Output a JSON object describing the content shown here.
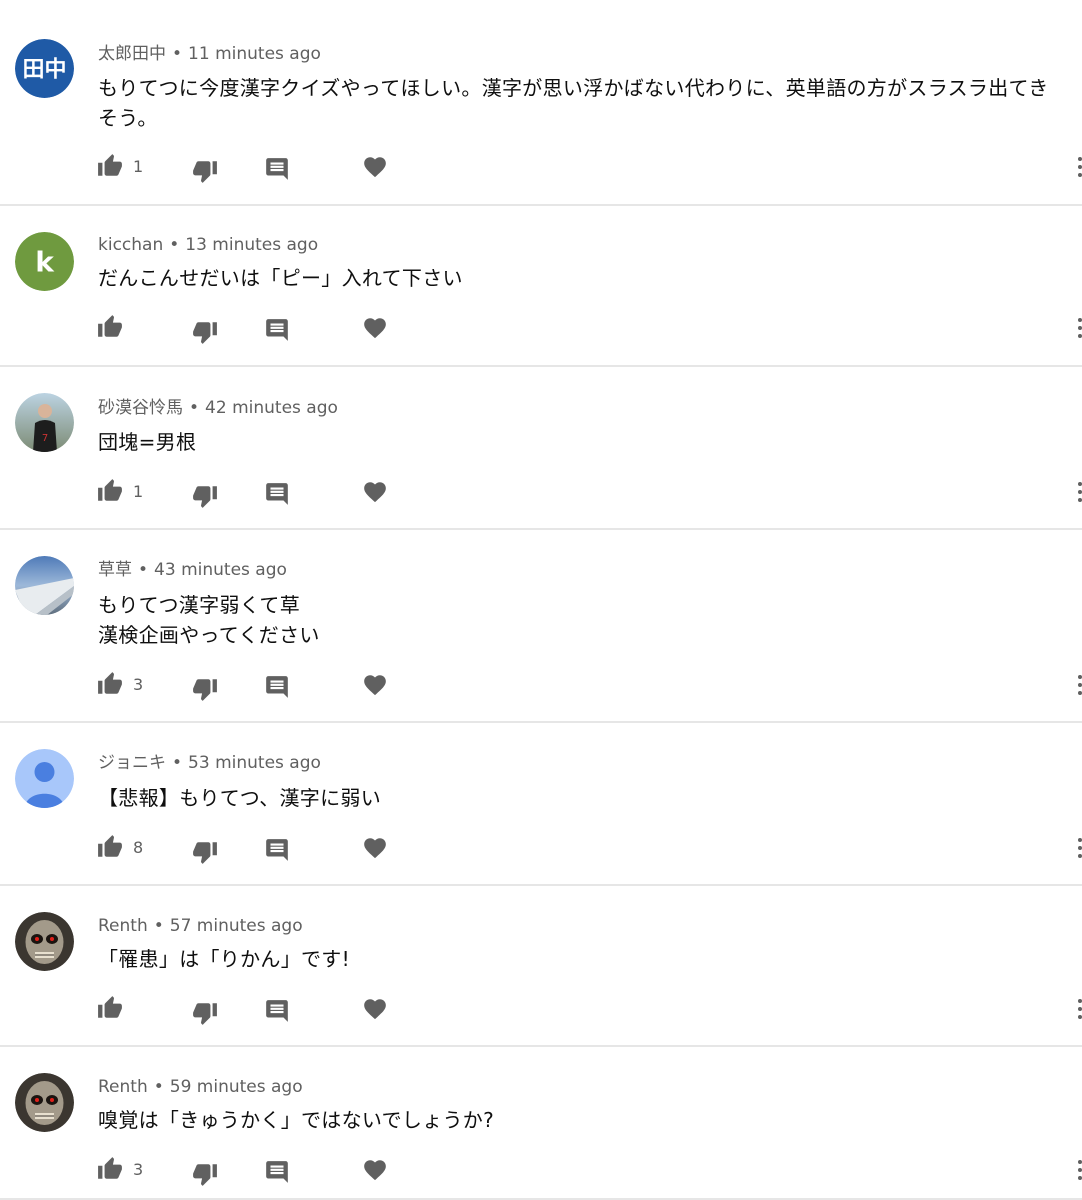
{
  "comments": [
    {
      "author": "太郎田中",
      "time": "11 minutes ago",
      "lines": [
        "もりてつに今度漢字クイズやってほしい。漢字が思い浮かばない代わりに、英単語の方がスラスラ出てき",
        "そう。"
      ],
      "likes": "1",
      "avatar": {
        "type": "initials",
        "text": "田中",
        "color": "#1f5aa6"
      }
    },
    {
      "author": "kicchan",
      "time": "13 minutes ago",
      "lines": [
        "だんこんせだいは「ピー」入れて下さい"
      ],
      "likes": "",
      "avatar": {
        "type": "initials",
        "text": "k",
        "color": "#6f9a3f"
      }
    },
    {
      "author": "砂漠谷怜馬",
      "time": "42 minutes ago",
      "lines": [
        "団塊=男根"
      ],
      "likes": "1",
      "avatar": {
        "type": "photo-person"
      }
    },
    {
      "author": "草草",
      "time": "43 minutes ago",
      "lines": [
        "もりてつ漢字弱くて草",
        "漢検企画やってください"
      ],
      "likes": "3",
      "avatar": {
        "type": "photo-wing"
      }
    },
    {
      "author": "ジョニキ",
      "time": "53 minutes ago",
      "lines": [
        "【悲報】もりてつ、漢字に弱い"
      ],
      "likes": "8",
      "avatar": {
        "type": "default-person",
        "color": "#a8c7fa",
        "fg": "#4a7fe0"
      }
    },
    {
      "author": "Renth",
      "time": "57 minutes ago",
      "lines": [
        "「罹患」は「りかん」です!"
      ],
      "likes": "",
      "avatar": {
        "type": "photo-skull"
      }
    },
    {
      "author": "Renth",
      "time": "59 minutes ago",
      "lines": [
        "嗅覚は「きゅうかく」ではないでしょうか?"
      ],
      "likes": "3",
      "avatar": {
        "type": "photo-skull"
      }
    }
  ],
  "icons": {
    "like": "thumbs-up-icon",
    "dislike": "thumbs-down-icon",
    "reply": "reply-icon",
    "heart": "heart-icon",
    "more": "more-vert-icon"
  }
}
